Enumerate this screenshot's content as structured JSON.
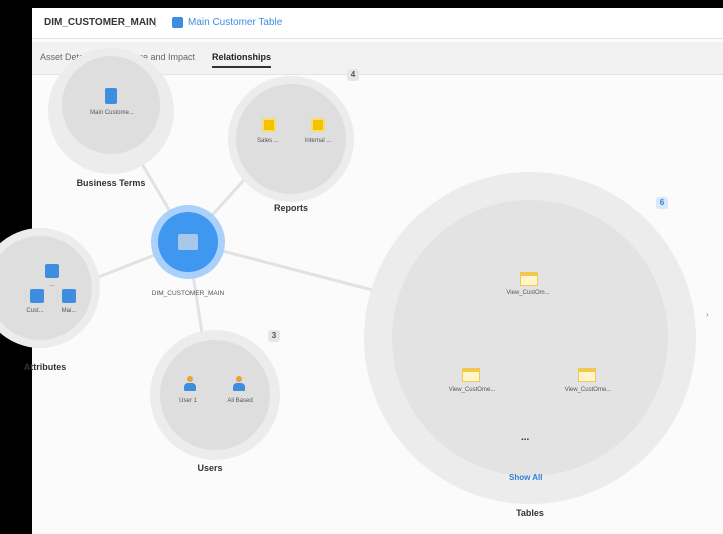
{
  "topbar": {
    "crumb_left": "DIM_CUSTOMER_MAIN",
    "separator": "|",
    "crumb_right": "Main Customer Table",
    "crumb_icon": "table-icon"
  },
  "tabs": [
    {
      "label": "Asset Details",
      "active": false
    },
    {
      "label": "Lineage and Impact",
      "active": false
    },
    {
      "label": "Relationships",
      "active": true
    }
  ],
  "graph": {
    "center": {
      "label": "DIM_CUSTOMER_MAIN",
      "icon": "table-icon"
    },
    "business_terms": {
      "label": "Business Terms",
      "items": [
        "Main Custome..."
      ]
    },
    "reports": {
      "label": "Reports",
      "badge": "4",
      "items": [
        "Sales ...",
        "Internal ..."
      ]
    },
    "attributes": {
      "label": "Attributes",
      "items": [
        "...",
        "Cust...",
        "Mai..."
      ]
    },
    "users": {
      "label": "Users",
      "badge": "3",
      "items": [
        "User 1",
        "Ali Based"
      ]
    },
    "tables": {
      "label": "Tables",
      "badge": "6",
      "items": [
        "View_CustOm...",
        "View_CustOme...",
        "View_CustOme..."
      ],
      "ellipsis": "...",
      "more_link": "Show All"
    }
  },
  "colors": {
    "accent": "#3f8ddf",
    "center_fill": "#3f97ef",
    "bubble_outer": "#ececec",
    "bubble_inner": "#dedede",
    "report_icon": "#f3c300"
  },
  "scroll_hint": "›"
}
